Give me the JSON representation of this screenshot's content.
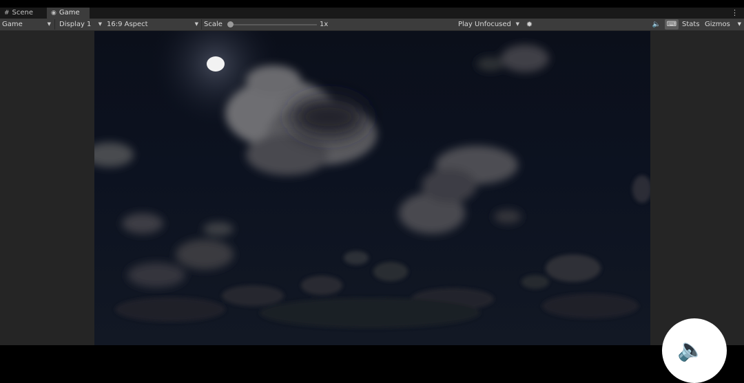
{
  "tabs": [
    {
      "label": "Scene",
      "icon": "grid-icon",
      "active": false
    },
    {
      "label": "Game",
      "icon": "gamepad-icon",
      "active": true
    }
  ],
  "toolbar": {
    "game_view": "Game",
    "display": "Display 1",
    "aspect": "16:9 Aspect",
    "scale_label": "Scale",
    "scale_value": "1x",
    "play_mode": "Play Unfocused",
    "stats": "Stats",
    "gizmos": "Gizmos"
  },
  "icons": {
    "kebab": "more-vertical-icon",
    "bug": "bug-icon",
    "mute": "speaker-icon",
    "keyboard": "keyboard-icon",
    "floating_audio": "speaker-icon"
  },
  "colors": {
    "panel": "#3c3c3c",
    "tabstrip": "#191919",
    "sidebar": "#252525",
    "sky": "#0c1220",
    "moon": "#f2f2f2"
  }
}
